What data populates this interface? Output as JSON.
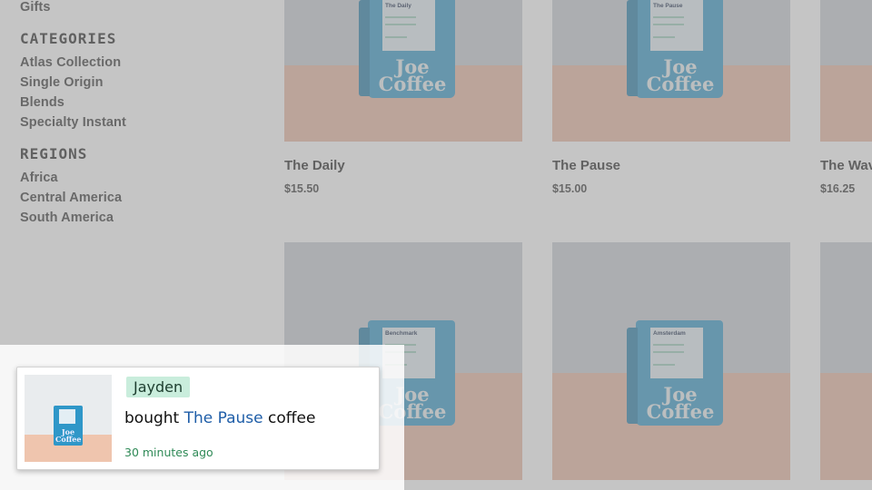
{
  "sidebar": {
    "top_link": "Gifts",
    "categories_heading": "CATEGORIES",
    "categories": [
      "Atlas Collection",
      "Single Origin",
      "Blends",
      "Specialty Instant"
    ],
    "regions_heading": "REGIONS",
    "regions": [
      "Africa",
      "Central America",
      "South America"
    ]
  },
  "products": [
    {
      "name": "The Daily",
      "price": "$15.50",
      "bag_label": "The Daily"
    },
    {
      "name": "The Pause",
      "price": "$15.00",
      "bag_label": "The Pause"
    },
    {
      "name": "The Wav",
      "price": "$16.25",
      "bag_label": ""
    },
    {
      "bag_label": "Benchmark"
    },
    {
      "bag_label": "Amsterdam"
    }
  ],
  "bag_brand": "Joe Coffee",
  "notification": {
    "name": "Jayden",
    "prefix": "bought ",
    "product": "The Pause",
    "suffix": " coffee",
    "time": "30 minutes ago",
    "thumb_brand": "Joe Coffee"
  },
  "colors": {
    "bag_blue": "#2f97c8",
    "badge_green": "#c9eddc",
    "link_blue": "#1f5ea8",
    "time_green": "#2f8a57"
  }
}
